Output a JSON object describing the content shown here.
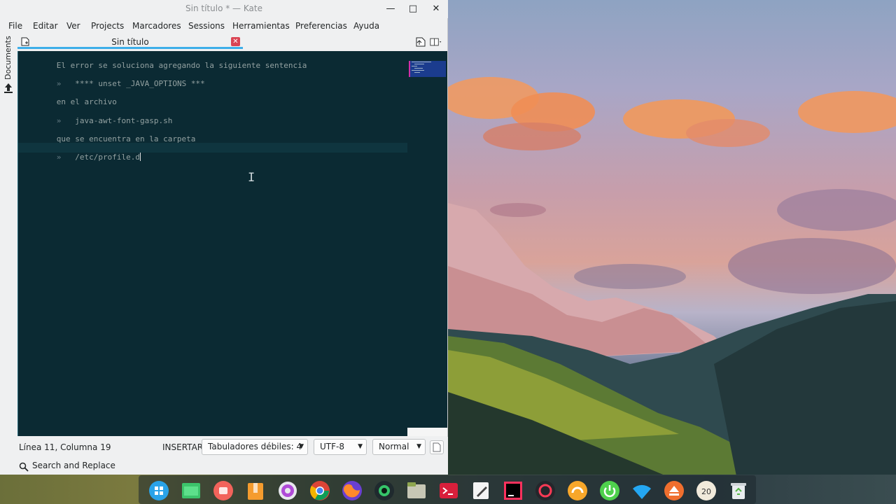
{
  "window": {
    "title": "Sin título * — Kate",
    "minimize": "—",
    "maximize": "□",
    "close": "✕"
  },
  "menu": [
    "File",
    "Editar",
    "Ver",
    "Projects",
    "Marcadores",
    "Sessions",
    "Herramientas",
    "Preferencias",
    "Ayuda"
  ],
  "tab": {
    "label": "Sin título",
    "close": "✕"
  },
  "sidebar": {
    "documents_label": "Documents"
  },
  "editor": {
    "lines": [
      {
        "bullet": "",
        "text": "El error se soluciona agregando la siguiente sentencia"
      },
      {
        "bullet": "»",
        "text": "**** unset _JAVA_OPTIONS ***"
      },
      {
        "bullet": "",
        "text": "en el archivo"
      },
      {
        "bullet": "»",
        "text": "java-awt-font-gasp.sh"
      },
      {
        "bullet": "",
        "text": "que se encuentra en la carpeta"
      },
      {
        "bullet": "»",
        "text": "/etc/profile.d"
      }
    ]
  },
  "status": {
    "position": "Línea 11, Columna 19",
    "mode": "INSERTAR",
    "tabs": "Tabuladores débiles: 4",
    "encoding": "UTF-8",
    "syntax": "Normal"
  },
  "bottom": {
    "search_label": "Search and Replace"
  },
  "colors": {
    "editor_bg": "#0b2a33",
    "tab_accent": "#3daee9",
    "close_red": "#da4453",
    "minimap_view": "#1b3c8e"
  },
  "dock_icons": [
    "app-launcher-icon",
    "file-manager-icon",
    "screenshot-icon",
    "archive-icon",
    "settings-gear-icon",
    "chrome-icon",
    "firefox-icon",
    "webcam-icon",
    "folder-icon",
    "terminal-icon",
    "text-editor-icon",
    "intellij-icon",
    "screen-recorder-icon",
    "audio-icon",
    "power-icon",
    "wifi-icon",
    "eject-icon",
    "clock-icon",
    "trash-icon"
  ]
}
